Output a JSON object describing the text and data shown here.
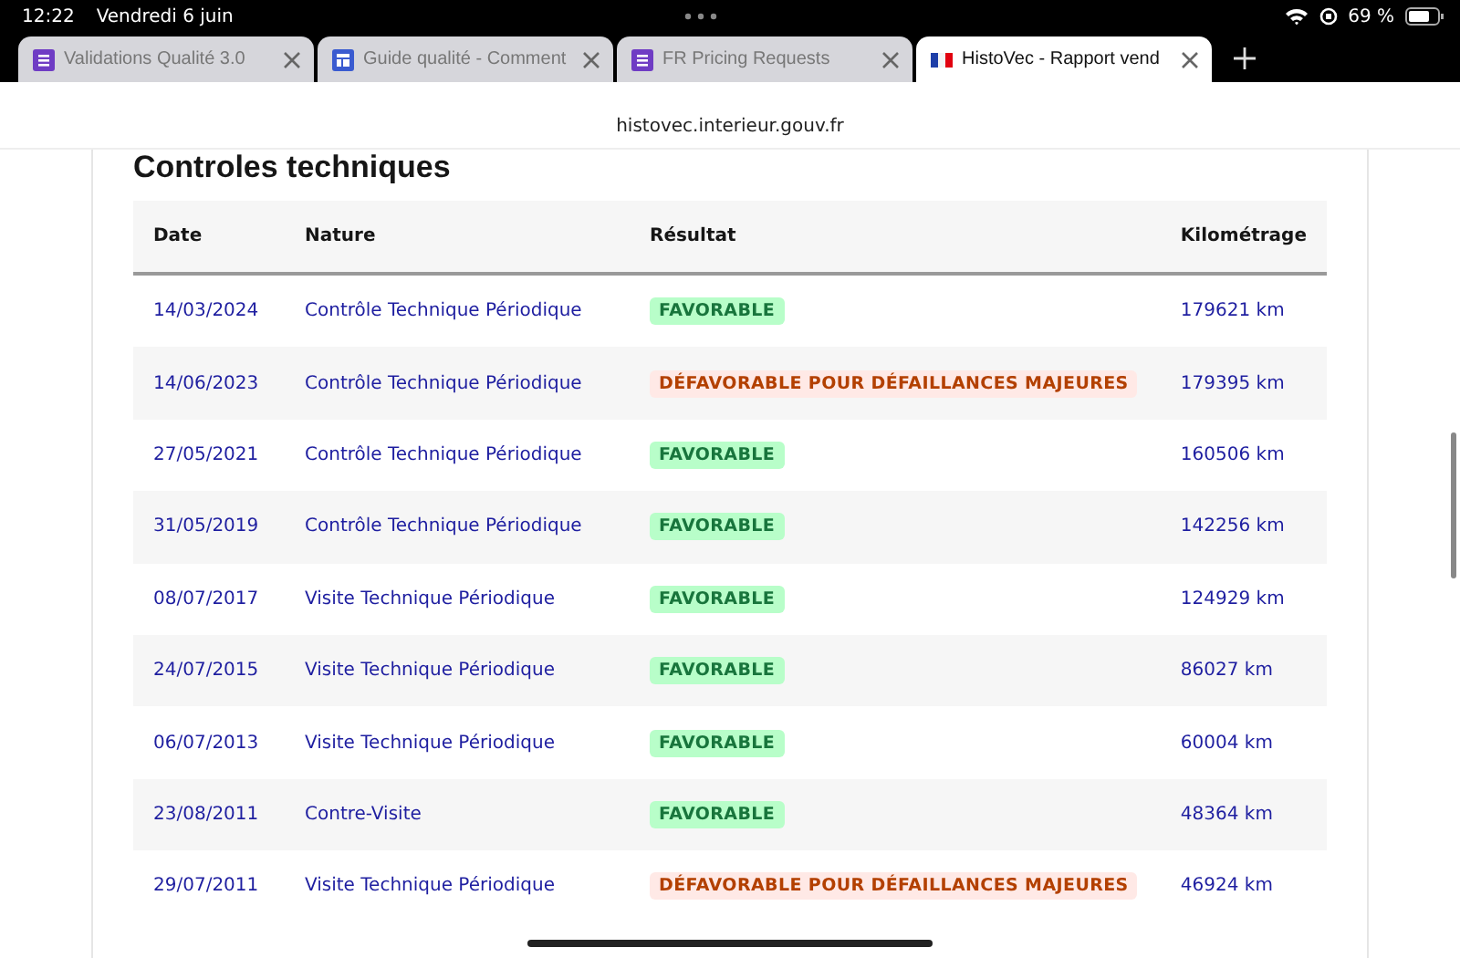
{
  "status_bar": {
    "time": "12:22",
    "date": "Vendredi 6 juin",
    "battery": "69 %"
  },
  "tabs": [
    {
      "label": "Validations Qualité 3.0",
      "selected": false
    },
    {
      "label": "Guide qualité - Comment",
      "selected": false
    },
    {
      "label": "FR Pricing Requests",
      "selected": false
    },
    {
      "label": "HistoVec - Rapport vend",
      "selected": true
    }
  ],
  "address": "histovec.interieur.gouv.fr",
  "heading": "Controles techniques",
  "table": {
    "columns": [
      "Date",
      "Nature",
      "Résultat",
      "Kilométrage"
    ],
    "rows": [
      {
        "date": "14/03/2024",
        "nature": "Contrôle Technique Périodique",
        "result": "FAVORABLE",
        "kind": "favorable",
        "km": "179621 km"
      },
      {
        "date": "14/06/2023",
        "nature": "Contrôle Technique Périodique",
        "result": "DÉFAVORABLE POUR DÉFAILLANCES MAJEURES",
        "kind": "defavorable",
        "km": "179395 km"
      },
      {
        "date": "27/05/2021",
        "nature": "Contrôle Technique Périodique",
        "result": "FAVORABLE",
        "kind": "favorable",
        "km": "160506 km"
      },
      {
        "date": "31/05/2019",
        "nature": "Contrôle Technique Périodique",
        "result": "FAVORABLE",
        "kind": "favorable",
        "km": "142256 km"
      },
      {
        "date": "08/07/2017",
        "nature": "Visite Technique Périodique",
        "result": "FAVORABLE",
        "kind": "favorable",
        "km": "124929 km"
      },
      {
        "date": "24/07/2015",
        "nature": "Visite Technique Périodique",
        "result": "FAVORABLE",
        "kind": "favorable",
        "km": "86027 km"
      },
      {
        "date": "06/07/2013",
        "nature": "Visite Technique Périodique",
        "result": "FAVORABLE",
        "kind": "favorable",
        "km": "60004 km"
      },
      {
        "date": "23/08/2011",
        "nature": "Contre-Visite",
        "result": "FAVORABLE",
        "kind": "favorable",
        "km": "48364 km"
      },
      {
        "date": "29/07/2011",
        "nature": "Visite Technique Périodique",
        "result": "DÉFAVORABLE POUR DÉFAILLANCES MAJEURES",
        "kind": "defavorable",
        "km": "46924 km"
      }
    ]
  }
}
